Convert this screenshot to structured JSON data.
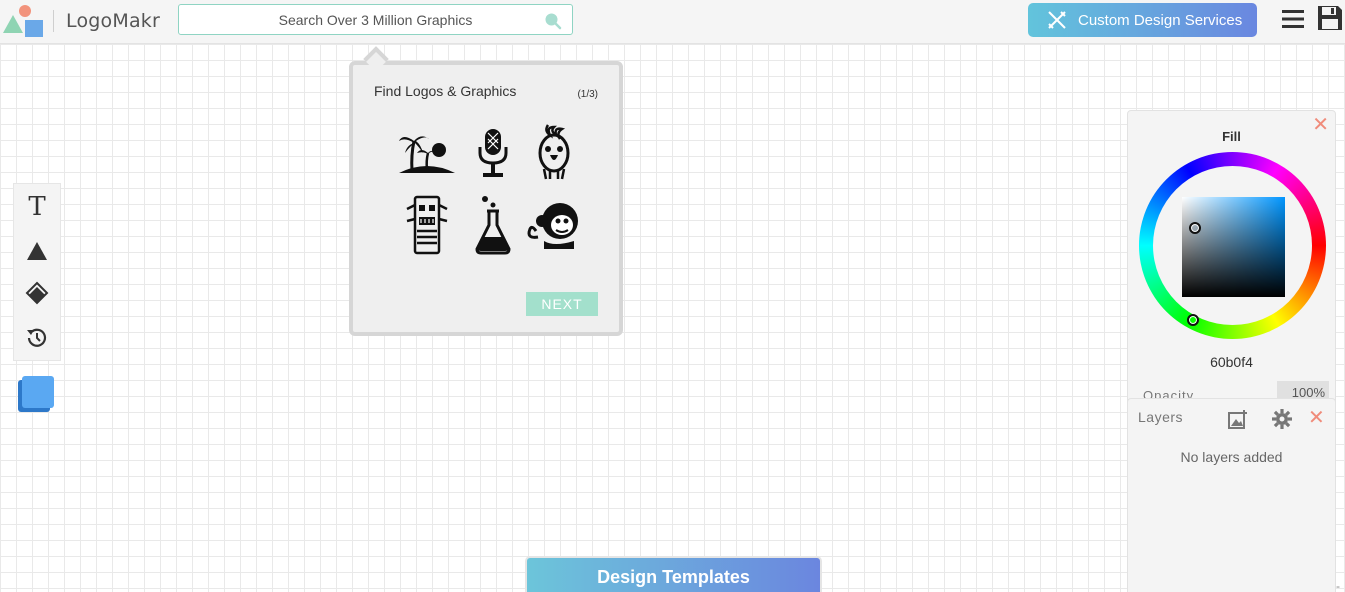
{
  "header": {
    "brand": "LogoMakr",
    "search": {
      "placeholder": "Search Over 3 Million Graphics"
    },
    "custom_design_label": "Custom Design Services",
    "icons": [
      "menu-icon",
      "save-icon"
    ]
  },
  "toolbar": {
    "tools": [
      "text-tool",
      "shape-tool",
      "fill-tool",
      "history-tool"
    ],
    "text_glyph": "T",
    "swatch_color": "#3d8fe6"
  },
  "tutorial": {
    "title": "Find Logos & Graphics",
    "step": "(1/3)",
    "graphics": [
      "palm-island-icon",
      "microphone-icon",
      "cockatoo-icon",
      "tiki-icon",
      "flask-icon",
      "monkey-icon"
    ],
    "next_label": "NEXT"
  },
  "fill_panel": {
    "title": "Fill",
    "hex": "60b0f4",
    "opacity_label": "Opacity",
    "opacity_value": "100%",
    "close": "✕"
  },
  "layers_panel": {
    "title": "Layers",
    "empty_text": "No layers added",
    "close": "✕"
  },
  "templates_label": "Design Templates",
  "colors": {
    "accent_teal": "#8fd4c3",
    "gradient_start": "#62c4dc",
    "gradient_end": "#6a87e0",
    "close_red": "#f08b7a"
  }
}
